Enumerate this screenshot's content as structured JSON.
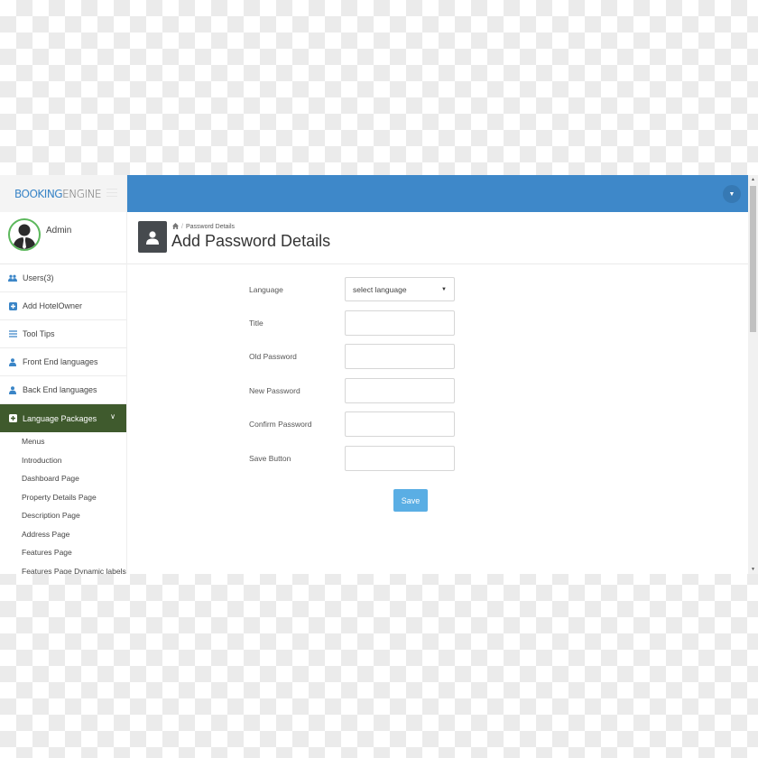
{
  "brand": {
    "logo_primary": "BOOKING",
    "logo_secondary": "ENGINE",
    "accent_color": "#3e88c9"
  },
  "profile": {
    "name": "Admin"
  },
  "sidebar": {
    "items": [
      {
        "label": "Users(3)",
        "icon": "users-icon"
      },
      {
        "label": "Add HotelOwner",
        "icon": "plus-square-icon"
      },
      {
        "label": "Tool Tips",
        "icon": "list-icon"
      },
      {
        "label": "Front End languages",
        "icon": "user-icon"
      },
      {
        "label": "Back End languages",
        "icon": "user-icon"
      },
      {
        "label": "Language Packages",
        "icon": "plus-square-icon",
        "active": true,
        "expanded": true
      }
    ],
    "sub_items": [
      "Menus",
      "Introduction",
      "Dashboard Page",
      "Property Details Page",
      "Description Page",
      "Address Page",
      "Features Page",
      "Features Page Dynamic labels"
    ]
  },
  "header": {
    "breadcrumb": [
      "home-icon",
      "Password Details"
    ],
    "breadcrumb_current": "Password Details",
    "title": "Add Password Details"
  },
  "form": {
    "fields": [
      {
        "label": "Language",
        "type": "select",
        "value": "select language"
      },
      {
        "label": "Title",
        "type": "text",
        "value": ""
      },
      {
        "label": "Old Password",
        "type": "text",
        "value": ""
      },
      {
        "label": "New Password",
        "type": "text",
        "value": ""
      },
      {
        "label": "Confirm Password",
        "type": "text",
        "value": ""
      },
      {
        "label": "Save Button",
        "type": "text",
        "value": ""
      }
    ],
    "submit_label": "Save"
  }
}
